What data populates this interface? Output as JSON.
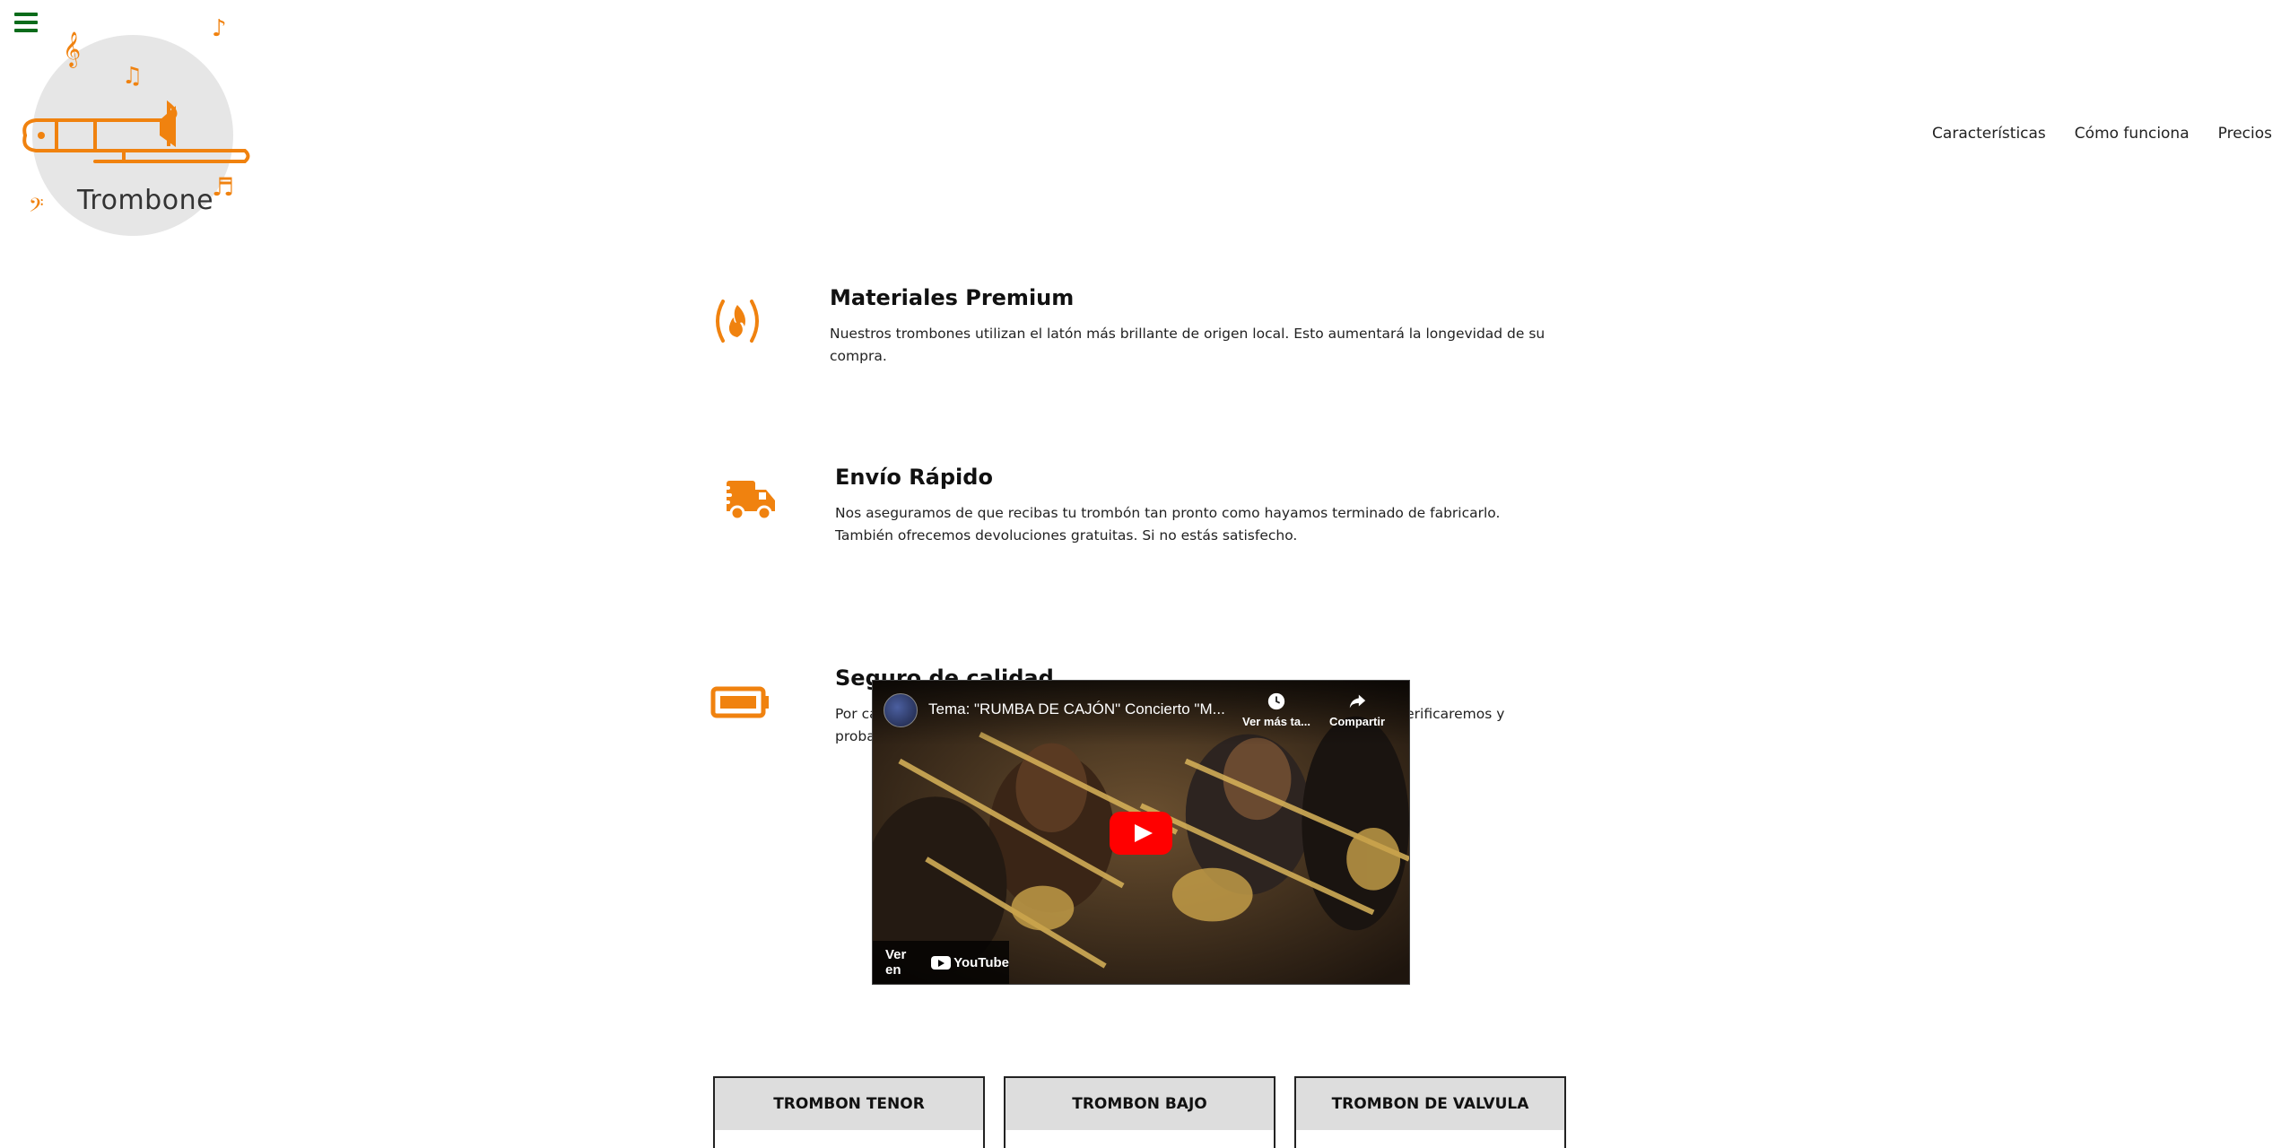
{
  "brand": {
    "name": "Trombone",
    "accent_color": "#f0820f",
    "menu_icon": "hamburger-menu-icon"
  },
  "nav": {
    "items": [
      "Características",
      "Cómo funciona",
      "Precios"
    ]
  },
  "features": [
    {
      "icon": "fire-icon",
      "title": "Materiales Premium",
      "description": "Nuestros trombones utilizan el latón más brillante de origen local. Esto aumentará la longevidad de su compra."
    },
    {
      "icon": "truck-icon",
      "title": "Envío Rápido",
      "description": "Nos aseguramos de que recibas tu trombón tan pronto como hayamos terminado de fabricarlo. También ofrecemos devoluciones gratuitas. Si no estás satisfecho."
    },
    {
      "icon": "battery-icon",
      "title": "Seguro de calidad",
      "description": "Por cada compra que realice, nos aseguraremos de que no haya daños ni fallas. Verificaremos y probaremos el tono de su instrumento."
    }
  ],
  "video": {
    "title": "Tema: \"RUMBA DE CAJÓN\" Concierto \"M...",
    "watch_later_label": "Ver más ta...",
    "share_label": "Compartir",
    "watch_on_label": "Ver en",
    "youtube_label": "YouTube"
  },
  "pricing": {
    "cards": [
      {
        "title": "TROMBON TENOR"
      },
      {
        "title": "TROMBON BAJO"
      },
      {
        "title": "TROMBON DE VALVULA"
      }
    ]
  }
}
